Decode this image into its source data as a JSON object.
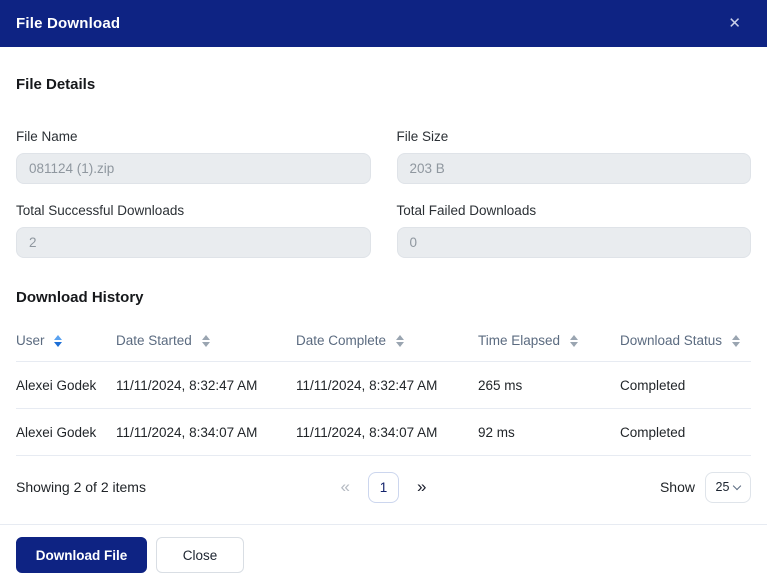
{
  "colors": {
    "primary": "#0e2383",
    "divider": "#e7ebf2",
    "input-bg": "#e9ecef",
    "th-text": "#5b6b80"
  },
  "modal": {
    "title": "File Download",
    "close_glyph": "✕"
  },
  "file_details": {
    "heading": "File Details",
    "fields": [
      {
        "label": "File Name",
        "value": "081124 (1).zip"
      },
      {
        "label": "File Size",
        "value": "203 B"
      },
      {
        "label": "Total Successful Downloads",
        "value": "2"
      },
      {
        "label": "Total Failed Downloads",
        "value": "0"
      }
    ]
  },
  "download_history": {
    "heading": "Download History",
    "columns": [
      {
        "label": "User",
        "sorted": true
      },
      {
        "label": "Date Started",
        "sorted": false
      },
      {
        "label": "Date Complete",
        "sorted": false
      },
      {
        "label": "Time Elapsed",
        "sorted": false
      },
      {
        "label": "Download Status",
        "sorted": false
      }
    ],
    "rows": [
      [
        "Alexei Godek",
        "11/11/2024, 8:32:47 AM",
        "11/11/2024, 8:32:47 AM",
        "265 ms",
        "Completed"
      ],
      [
        "Alexei Godek",
        "11/11/2024, 8:34:07 AM",
        "11/11/2024, 8:34:07 AM",
        "92 ms",
        "Completed"
      ]
    ]
  },
  "pagination": {
    "summary": "Showing 2 of 2 items",
    "prev_glyph": "«",
    "current_page": "1",
    "next_glyph": "»",
    "show_label": "Show",
    "page_size": "25"
  },
  "footer": {
    "download_label": "Download File",
    "close_label": "Close"
  }
}
